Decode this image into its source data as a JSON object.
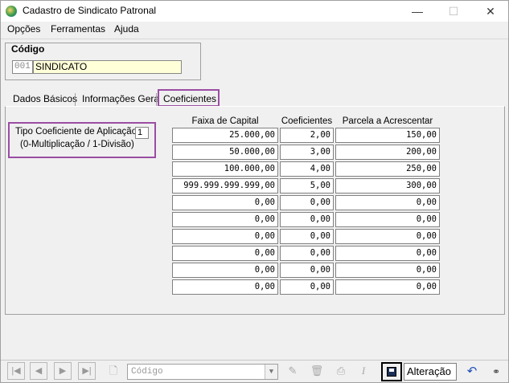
{
  "window": {
    "title": "Cadastro de Sindicato Patronal",
    "minimize": "—",
    "maximize": "☐",
    "close": "✕"
  },
  "menu": [
    "Opções",
    "Ferramentas",
    "Ajuda"
  ],
  "codigo": {
    "label": "Código",
    "prefix": "001",
    "name": "SINDICATO"
  },
  "tabs": [
    "Dados Básicos",
    "Informações Gerais",
    "Coeficientes"
  ],
  "coeficientes": {
    "tipo_label": "Tipo Coeficiente de Aplicação:",
    "tipo_value": "1",
    "tipo_hint": "(0-Multiplicação / 1-Divisão)",
    "headers": [
      "Faixa de Capital",
      "Coeficientes",
      "Parcela a Acrescentar"
    ],
    "rows": [
      [
        "25.000,00",
        "2,00",
        "150,00"
      ],
      [
        "50.000,00",
        "3,00",
        "200,00"
      ],
      [
        "100.000,00",
        "4,00",
        "250,00"
      ],
      [
        "999.999.999.999,00",
        "5,00",
        "300,00"
      ],
      [
        "0,00",
        "0,00",
        "0,00"
      ],
      [
        "0,00",
        "0,00",
        "0,00"
      ],
      [
        "0,00",
        "0,00",
        "0,00"
      ],
      [
        "0,00",
        "0,00",
        "0,00"
      ],
      [
        "0,00",
        "0,00",
        "0,00"
      ],
      [
        "0,00",
        "0,00",
        "0,00"
      ]
    ]
  },
  "toolbar": {
    "nav": [
      "|◀",
      "◀",
      "▶",
      "▶|"
    ],
    "search_placeholder": "Código",
    "status": "Alteração"
  }
}
